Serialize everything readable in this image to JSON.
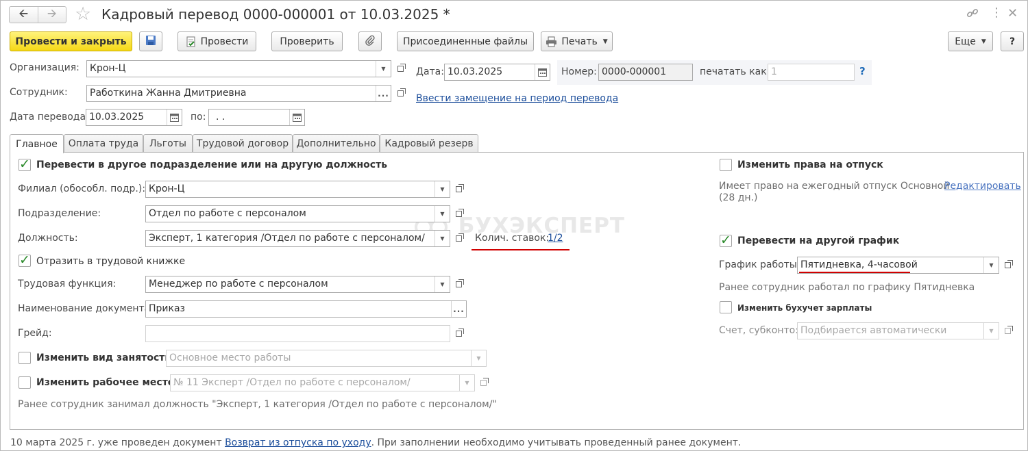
{
  "window": {
    "title": "Кадровый перевод 0000-000001 от 10.03.2025 *",
    "icons": [
      "arrow-left-icon",
      "arrow-right-icon",
      "star-icon",
      "link-icon",
      "more-icon",
      "close-icon"
    ]
  },
  "toolbar": {
    "post_close": "Провести и закрыть",
    "post": "Провести",
    "check": "Проверить",
    "attached": "Присоединенные файлы",
    "print": "Печать",
    "more": "Еще",
    "help": "?"
  },
  "header": {
    "org_label": "Организация:",
    "org_value": "Крон-Ц",
    "emp_label": "Сотрудник:",
    "emp_value": "Работкина Жанна Дмитриевна",
    "date_label": "Дата:",
    "date_value": "10.03.2025",
    "number_label": "Номер:",
    "number_value": "0000-000001",
    "print_as_label": "печатать как:",
    "print_as_placeholder": "1",
    "print_as_help": "?",
    "substitute_link": "Ввести замещение на период перевода",
    "transfer_date_label": "Дата перевода:",
    "transfer_date_value": "10.03.2025",
    "to_label": "по:",
    "to_value": " .  ."
  },
  "tabs": [
    {
      "label": "Главное"
    },
    {
      "label": "Оплата труда"
    },
    {
      "label": "Льготы"
    },
    {
      "label": "Трудовой договор"
    },
    {
      "label": "Дополнительно"
    },
    {
      "label": "Кадровый резерв"
    }
  ],
  "main": {
    "transfer_checkbox_label": "Перевести в другое подразделение или на другую должность",
    "transfer_checked": true,
    "branch_label": "Филиал (обособл. подр.):",
    "branch_value": "Крон-Ц",
    "dept_label": "Подразделение:",
    "dept_value": "Отдел по работе с персоналом",
    "position_label": "Должность:",
    "position_value": "Эксперт, 1 категория /Отдел по работе с персоналом/",
    "rates_label": "Колич. ставок:",
    "rates_value": "1/2",
    "workbook_label": "Отразить в трудовой книжке",
    "workbook_checked": true,
    "labor_function_label": "Трудовая функция:",
    "labor_function_value": "Менеджер по работе с персоналом",
    "doc_name_label": "Наименование документа:",
    "doc_name_value": "Приказ",
    "grade_label": "Грейд:",
    "grade_value": "",
    "employment_type_label": "Изменить вид занятости",
    "employment_type_value": "Основное место работы",
    "workplace_label": "Изменить рабочее место",
    "workplace_value": "№ 11 Эксперт /Отдел по работе с персоналом/",
    "previous_position_note": "Ранее сотрудник занимал должность \"Эксперт, 1 категория /Отдел по работе с персоналом/\""
  },
  "right": {
    "vacation_label": "Изменить права на отпуск",
    "vacation_checked": false,
    "vacation_note_line1": "Имеет право на ежегодный отпуск Основной",
    "vacation_note_line2": "(28 дн.)",
    "edit_link": "Редактировать",
    "schedule_label": "Перевести на другой график",
    "schedule_checked": true,
    "work_schedule_label": "График работы:",
    "work_schedule_value": "Пятидневка, 4-часовой",
    "prev_schedule_note": "Ранее сотрудник работал по графику Пятидневка",
    "accounting_label": "Изменить бухучет зарплаты",
    "accounting_checked": false,
    "account_label": "Счет, субконто:",
    "account_placeholder": "Подбирается автоматически"
  },
  "watermark": "БУХЭКСПЕРТ",
  "footer": {
    "prefix": "10 марта 2025 г. уже проведен документ ",
    "link": "Возврат из отпуска по уходу",
    "suffix": ". При заполнении необходимо учитывать проведенный ранее документ."
  },
  "colors": {
    "primary_button": "#f5d816",
    "link": "#1c4e9b",
    "checkmark": "#2b8a2b",
    "highlight_underline": "#d10000"
  }
}
